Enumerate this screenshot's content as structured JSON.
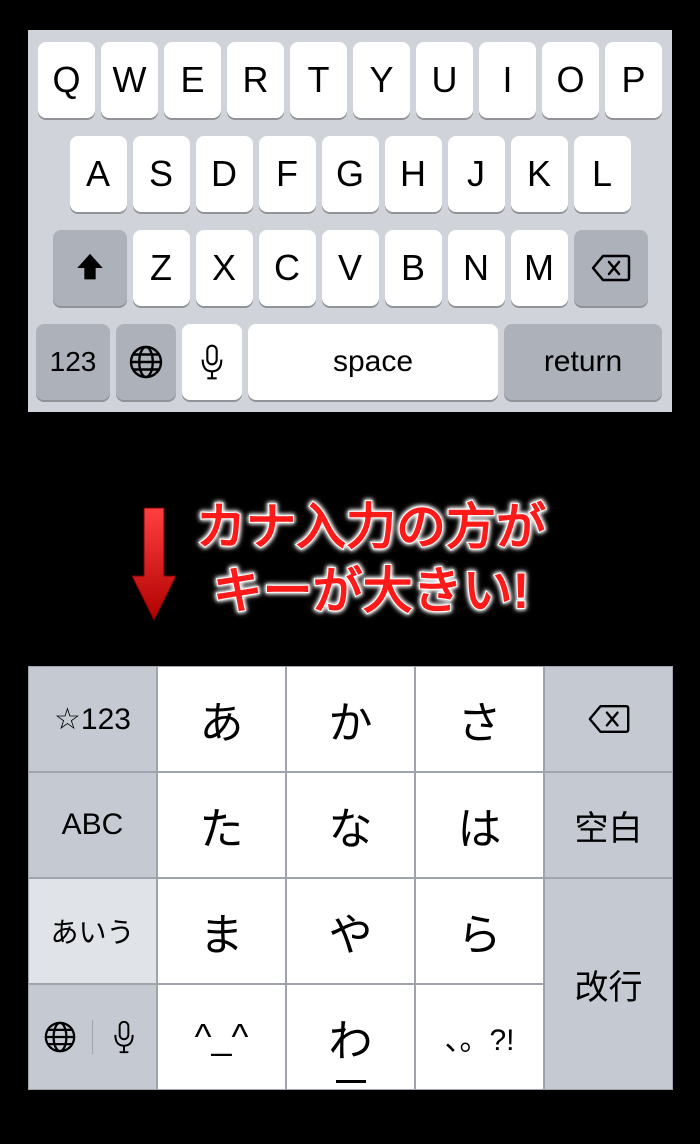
{
  "qwerty": {
    "row1": [
      "Q",
      "W",
      "E",
      "R",
      "T",
      "Y",
      "U",
      "I",
      "O",
      "P"
    ],
    "row2": [
      "A",
      "S",
      "D",
      "F",
      "G",
      "H",
      "J",
      "K",
      "L"
    ],
    "row3": [
      "Z",
      "X",
      "C",
      "V",
      "B",
      "N",
      "M"
    ],
    "switch_label": "123",
    "space_label": "space",
    "return_label": "return"
  },
  "annotation": {
    "line1": "カナ入力の方が",
    "line2": "キーが大きい!"
  },
  "kana": {
    "star123": "☆123",
    "abc": "ABC",
    "aiu": "あいう",
    "space_jp": "空白",
    "return_jp": "改行",
    "grid": {
      "r1": [
        "あ",
        "か",
        "さ"
      ],
      "r2": [
        "た",
        "な",
        "は"
      ],
      "r3": [
        "ま",
        "や",
        "ら"
      ],
      "r4": [
        "^_^",
        "わ",
        "、。?!"
      ]
    }
  }
}
